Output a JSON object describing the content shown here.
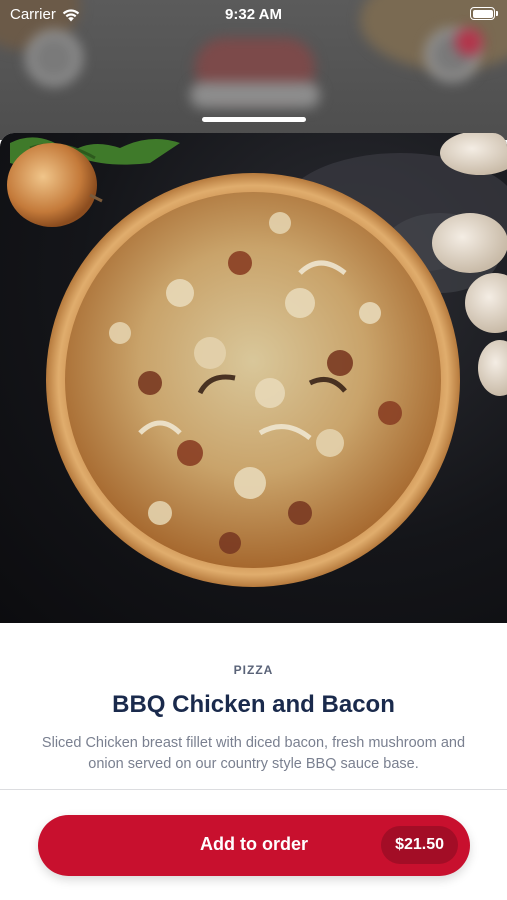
{
  "status_bar": {
    "carrier": "Carrier",
    "time": "9:32 AM"
  },
  "product": {
    "category": "PIZZA",
    "name": "BBQ Chicken and Bacon",
    "description": "Sliced Chicken breast fillet with diced bacon, fresh mushroom and onion served on our country style BBQ sauce base."
  },
  "order_button": {
    "label": "Add to order",
    "price": "$21.50"
  },
  "colors": {
    "accent": "#c8102e",
    "price_pill": "#a30d26",
    "title": "#1a2a4c"
  },
  "icons": [
    "wifi-icon",
    "battery-icon"
  ]
}
